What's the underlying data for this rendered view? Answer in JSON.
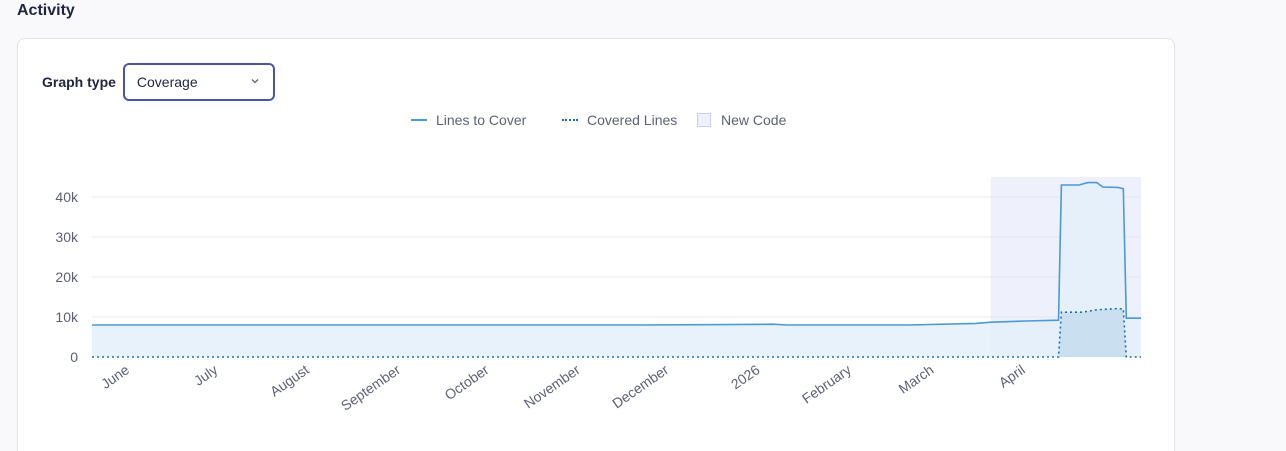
{
  "section": {
    "title": "Activity"
  },
  "graph_type": {
    "label": "Graph type",
    "selected": "Coverage"
  },
  "legend": {
    "lines_to_cover": "Lines to Cover",
    "covered_lines": "Covered Lines",
    "new_code": "New Code"
  },
  "colors": {
    "accent": "#4a55a8",
    "lines_to_cover": "#4a9ad6",
    "covered_lines": "#1f6fb0",
    "area_fill": "#e4f0f9",
    "new_code_fill": "#eef0fb"
  },
  "chart_data": {
    "type": "area",
    "title": "",
    "xlabel": "",
    "ylabel": "",
    "ylim": [
      0,
      45000
    ],
    "y_ticks": [
      {
        "value": 0,
        "label": "0"
      },
      {
        "value": 10000,
        "label": "10k"
      },
      {
        "value": 20000,
        "label": "20k"
      },
      {
        "value": 30000,
        "label": "30k"
      },
      {
        "value": 40000,
        "label": "40k"
      }
    ],
    "x_ticks": [
      "June",
      "July",
      "August",
      "September",
      "October",
      "November",
      "December",
      "2026",
      "February",
      "March",
      "April"
    ],
    "x_range": [
      "2025-05-19",
      "2026-05-10"
    ],
    "new_code_period": [
      "2026-03-20",
      "2026-05-10"
    ],
    "series": [
      {
        "name": "Lines to Cover",
        "style": "solid",
        "points": [
          [
            "2025-05-19",
            8000
          ],
          [
            "2025-11-20",
            8000
          ],
          [
            "2025-12-20",
            8100
          ],
          [
            "2026-01-05",
            8200
          ],
          [
            "2026-01-10",
            8000
          ],
          [
            "2026-02-20",
            8000
          ],
          [
            "2026-03-15",
            8400
          ],
          [
            "2026-03-20",
            8700
          ],
          [
            "2026-04-01",
            9000
          ],
          [
            "2026-04-12",
            9200
          ],
          [
            "2026-04-13",
            43000
          ],
          [
            "2026-04-19",
            43000
          ],
          [
            "2026-04-22",
            43600
          ],
          [
            "2026-04-25",
            43600
          ],
          [
            "2026-04-27",
            42500
          ],
          [
            "2026-05-02",
            42400
          ],
          [
            "2026-05-04",
            42100
          ],
          [
            "2026-05-05",
            9700
          ],
          [
            "2026-05-10",
            9700
          ]
        ]
      },
      {
        "name": "Covered Lines",
        "style": "dotted",
        "points": [
          [
            "2025-05-19",
            0
          ],
          [
            "2026-04-12",
            0
          ],
          [
            "2026-04-13",
            11200
          ],
          [
            "2026-04-20",
            11200
          ],
          [
            "2026-04-25",
            11800
          ],
          [
            "2026-05-02",
            12100
          ],
          [
            "2026-05-04",
            12000
          ],
          [
            "2026-05-05",
            0
          ],
          [
            "2026-05-10",
            0
          ]
        ]
      }
    ],
    "grid": true,
    "legend_position": "top-center"
  }
}
